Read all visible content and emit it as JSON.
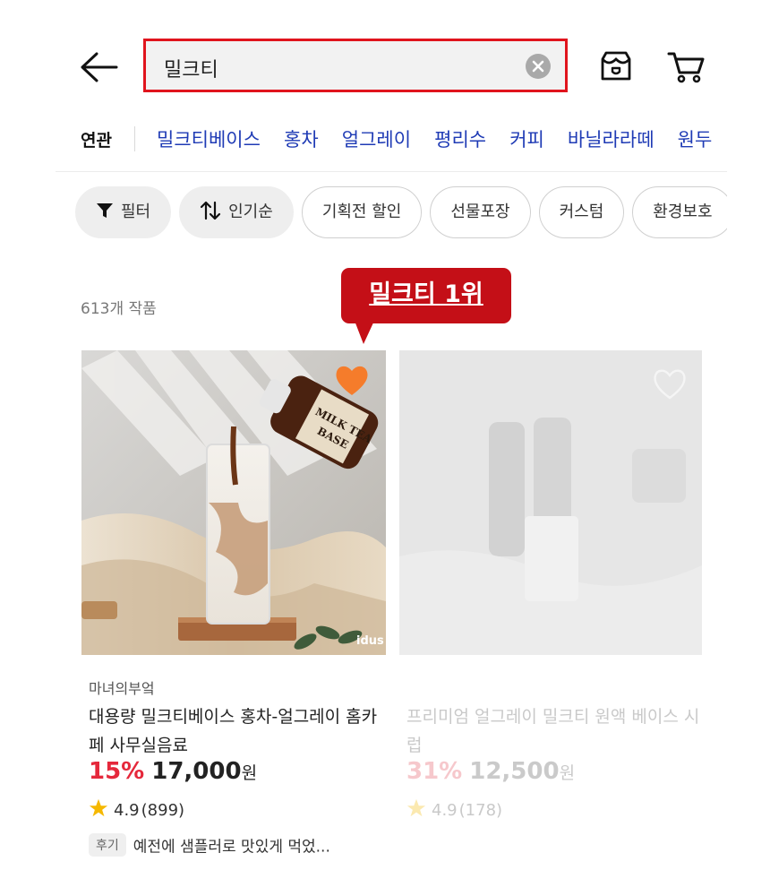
{
  "search": {
    "query": "밀크티"
  },
  "related": {
    "label": "연관",
    "keywords": [
      "밀크티베이스",
      "홍차",
      "얼그레이",
      "평리수",
      "커피",
      "바닐라라떼",
      "원두"
    ]
  },
  "chips": [
    {
      "label": "필터",
      "icon": "funnel-icon",
      "style": "filled"
    },
    {
      "label": "인기순",
      "icon": "sort-arrows-icon",
      "style": "filled"
    },
    {
      "label": "기획전 할인",
      "style": "outline"
    },
    {
      "label": "선물포장",
      "style": "outline"
    },
    {
      "label": "커스텀",
      "style": "outline"
    },
    {
      "label": "환경보호",
      "style": "outline"
    }
  ],
  "result_count": "613개 작품",
  "callout": {
    "text": "밀크티 1위"
  },
  "products": [
    {
      "seller": "마녀의부엌",
      "title": "대용량 밀크티베이스 홍차-얼그레이 홈카페 사무실음료",
      "discount": "15%",
      "price": "17,000",
      "currency": "원",
      "rating": "4.9",
      "reviews": "(899)",
      "review_badge": "후기",
      "review_snippet": "예전에 샘플러로 맛있게 먹었...",
      "image_watermark": "idus",
      "liked": true
    },
    {
      "seller": "",
      "title": "프리미엄 얼그레이 밀크티 원액 베이스 시럽",
      "discount": "31%",
      "price": "12,500",
      "currency": "원",
      "rating": "4.9",
      "reviews": "(178)",
      "liked": false
    }
  ],
  "colors": {
    "highlight": "#e0141d",
    "callout_bg": "#c40f17",
    "keyword": "#1f3bb5",
    "discount": "#e5283b",
    "heart": "#f57c2b",
    "star": "#f5b800"
  }
}
